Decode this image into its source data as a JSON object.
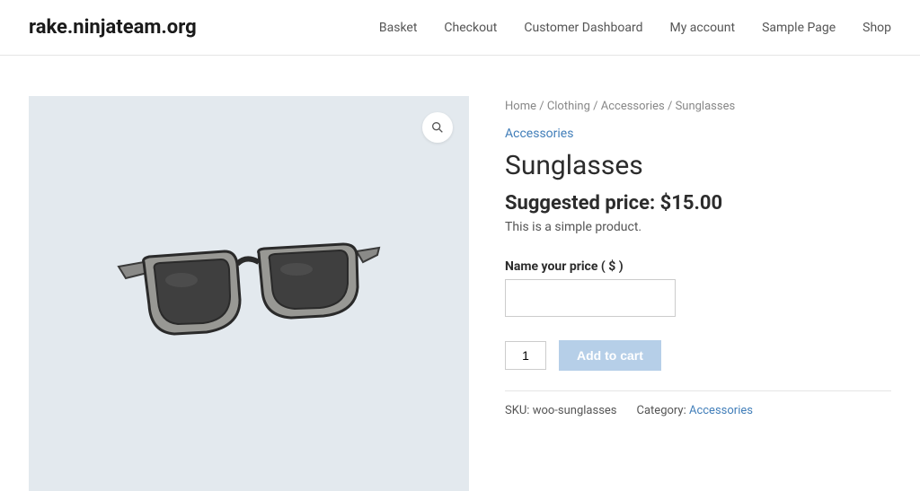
{
  "header": {
    "site_title": "rake.ninjateam.org",
    "nav": [
      "Basket",
      "Checkout",
      "Customer Dashboard",
      "My account",
      "Sample Page",
      "Shop"
    ]
  },
  "breadcrumb": {
    "items": [
      "Home",
      "Clothing",
      "Accessories",
      "Sunglasses"
    ],
    "sep": " / "
  },
  "product": {
    "category": "Accessories",
    "title": "Sunglasses",
    "price_label": "Suggested price: ",
    "price_value": "$15.00",
    "description": "This is a simple product.",
    "nyp_label": "Name your price ( $ )",
    "nyp_value": "",
    "qty": "1",
    "add_to_cart": "Add to cart"
  },
  "meta": {
    "sku_label": "SKU:",
    "sku_value": "woo-sunglasses",
    "cat_label": "Category:",
    "cat_value": "Accessories"
  },
  "zoom_icon": "search"
}
